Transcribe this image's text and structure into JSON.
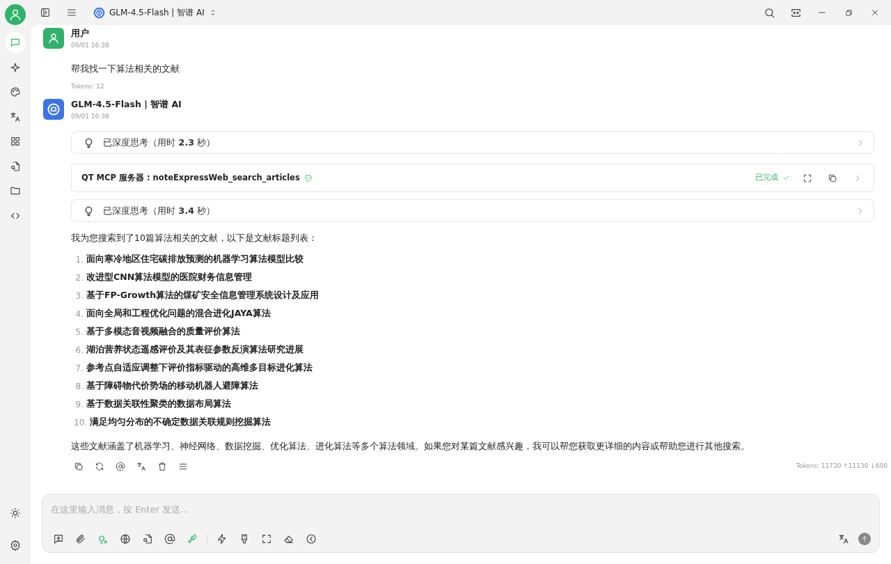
{
  "titlebar": {
    "model": "GLM-4.5-Flash | 智谱 AI"
  },
  "sidebar": {
    "items": [
      {
        "selected": true
      },
      {
        "selected": false
      },
      {
        "selected": false
      },
      {
        "selected": false
      },
      {
        "selected": false
      },
      {
        "selected": false
      },
      {
        "selected": false
      },
      {
        "selected": false
      }
    ],
    "bottom_items": [
      {
        "selected": false
      },
      {
        "selected": false
      }
    ]
  },
  "messages": [
    {
      "kind": "user",
      "author": "用户",
      "time": "09/01 16:38",
      "text": "帮我找一下算法相关的文献",
      "tokens": "Tokens: 12"
    },
    {
      "kind": "assistant",
      "author": "GLM-4.5-Flash | 智谱 AI",
      "time": "09/01 16:38",
      "blocks": [
        {
          "kind": "thinking",
          "text": "已深度思考（用时 **2.3** 秒）"
        },
        {
          "kind": "tool",
          "text": "QT MCP 服务器 : noteExpressWeb_search_articles",
          "status": "已完成"
        },
        {
          "kind": "thinking",
          "text": "已深度思考（用时 **3.4** 秒）"
        },
        {
          "kind": "paragraph",
          "text": "我为您搜索到了10篇算法相关的文献，以下是文献标题列表："
        },
        {
          "kind": "list",
          "items": [
            {
              "number": "1.",
              "text": "面向寒冷地区住宅碳排放预测的机器学习算法模型比较"
            },
            {
              "number": "2.",
              "text": "改进型CNN算法模型的医院财务信息管理"
            },
            {
              "number": "3.",
              "text": "基于FP-Growth算法的煤矿安全信息管理系统设计及应用"
            },
            {
              "number": "4.",
              "text": "面向全局和工程优化问题的混合进化JAYA算法"
            },
            {
              "number": "5.",
              "text": "基于多模态音视频融合的质量评价算法"
            },
            {
              "number": "6.",
              "text": "湖泊营养状态遥感评价及其表征参数反演算法研究进展"
            },
            {
              "number": "7.",
              "text": "参考点自适应调整下评价指标驱动的高维多目标进化算法"
            },
            {
              "number": "8.",
              "text": "基于障碍物代价势场的移动机器人避障算法"
            },
            {
              "number": "9.",
              "text": "基于数据关联性聚类的数据布局算法"
            },
            {
              "number": "10.",
              "text": "满足均匀分布的不确定数据关联规则挖掘算法"
            }
          ]
        },
        {
          "kind": "paragraph",
          "text": "这些文献涵盖了机器学习、神经网络、数据挖掘、优化算法、进化算法等多个算法领域。如果您对某篇文献感兴趣，我可以帮您获取更详细的内容或帮助您进行其他搜索。"
        }
      ],
      "tokens": "Tokens: 11730 ↑11130 ↓600"
    }
  ],
  "input": {
    "placeholder": "在这里输入消息，按 Enter 发送...",
    "tools": [
      {
        "on": false
      },
      {
        "on": false
      },
      {
        "on": true
      },
      {
        "on": false
      },
      {
        "on": false
      },
      {
        "on": false
      },
      {
        "on": true
      },
      {
        "on": false
      },
      {
        "on": false
      },
      {
        "on": false
      },
      {
        "on": false
      },
      {
        "on": false
      }
    ]
  }
}
